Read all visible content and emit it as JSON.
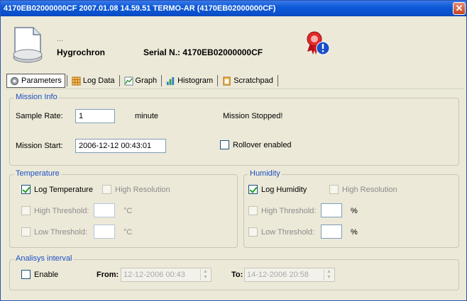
{
  "window": {
    "title": "4170EB02000000CF 2007.01.08 14.59.51 TERMO-AR  (4170EB02000000CF)",
    "close_glyph": "✕"
  },
  "header": {
    "dots": "...",
    "device_name": "Hygrochron",
    "serial": "Serial N.: 4170EB02000000CF"
  },
  "tabs": [
    {
      "label": "Parameters",
      "icon": "gear-icon"
    },
    {
      "label": "Log Data",
      "icon": "table-icon"
    },
    {
      "label": "Graph",
      "icon": "graph-icon"
    },
    {
      "label": "Histogram",
      "icon": "histogram-icon"
    },
    {
      "label": "Scratchpad",
      "icon": "notepad-icon"
    }
  ],
  "mission_info": {
    "legend": "Mission Info",
    "sample_rate_label": "Sample Rate:",
    "sample_rate_value": "1",
    "sample_rate_unit": "minute",
    "status": "Mission Stopped!",
    "mission_start_label": "Mission Start:",
    "mission_start_value": "2006-12-12 00:43:01",
    "rollover_label": "Rollover enabled",
    "rollover_checked": false
  },
  "temperature": {
    "legend": "Temperature",
    "log_label": "Log Temperature",
    "log_checked": true,
    "high_res_label": "High Resolution",
    "high_threshold_label": "High Threshold:",
    "low_threshold_label": "Low Threshold:",
    "unit": "°C"
  },
  "humidity": {
    "legend": "Humidity",
    "log_label": "Log Humidity",
    "log_checked": true,
    "high_res_label": "High Resolution",
    "high_threshold_label": "High Threshold:",
    "low_threshold_label": "Low Threshold:",
    "unit": "%"
  },
  "analysis": {
    "legend": "Analisys interval",
    "enable_label": "Enable",
    "from_label": "From:",
    "from_value": "12-12-2006 00:43",
    "to_label": "To:",
    "to_value": "14-12-2006 20:58"
  },
  "colors": {
    "title_bar": "#0d5ad8",
    "legend_text": "#1c4fc4",
    "window_bg": "#ece9d8"
  }
}
